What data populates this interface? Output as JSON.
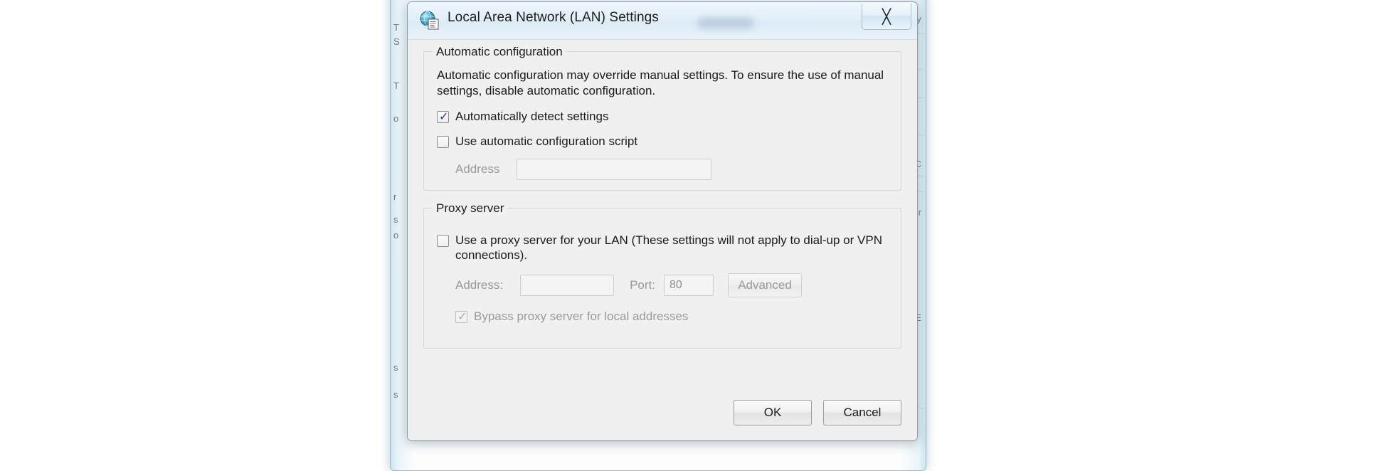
{
  "background_window": {
    "visible": true,
    "left_fragments": [
      "T",
      "S",
      "T",
      "o",
      "r",
      "s",
      "o",
      "s",
      "s"
    ],
    "right_fragments": [
      "y",
      "C",
      "r",
      "E"
    ]
  },
  "dialog": {
    "title": "Local Area Network (LAN) Settings",
    "title_icon": "globe-settings-icon",
    "close_icon": "close-icon",
    "close_glyph": "╳",
    "redacted_label": "",
    "automatic_configuration": {
      "legend": "Automatic configuration",
      "description": "Automatic configuration may override manual settings.  To ensure the use of manual settings, disable automatic configuration.",
      "auto_detect": {
        "label": "Automatically detect settings",
        "checked": true,
        "enabled": true,
        "tick": "✓"
      },
      "use_script": {
        "label": "Use automatic configuration script",
        "checked": false,
        "enabled": true,
        "tick": ""
      },
      "address": {
        "label": "Address",
        "value": "",
        "placeholder": "",
        "enabled": false
      }
    },
    "proxy_server": {
      "legend": "Proxy server",
      "use_proxy": {
        "label": "Use a proxy server for your LAN (These settings will not apply to dial-up or VPN connections).",
        "checked": false,
        "enabled": true,
        "tick": ""
      },
      "address": {
        "label": "Address:",
        "value": "",
        "placeholder": "",
        "enabled": false
      },
      "port": {
        "label": "Port:",
        "value": "80",
        "placeholder": "",
        "enabled": false
      },
      "advanced_button": {
        "label": "Advanced",
        "enabled": false
      },
      "bypass_local": {
        "label": "Bypass proxy server for local addresses",
        "checked": true,
        "enabled": false,
        "tick": "✓"
      }
    },
    "footer": {
      "ok_label": "OK",
      "cancel_label": "Cancel"
    }
  },
  "colors": {
    "dialog_face": "#f0f0f0",
    "titlebar": "#e2eff8",
    "text": "#1b1b1b",
    "disabled_text": "#9a9a9a",
    "check_mark": "#21436e",
    "group_border": "#d4d4d4"
  }
}
